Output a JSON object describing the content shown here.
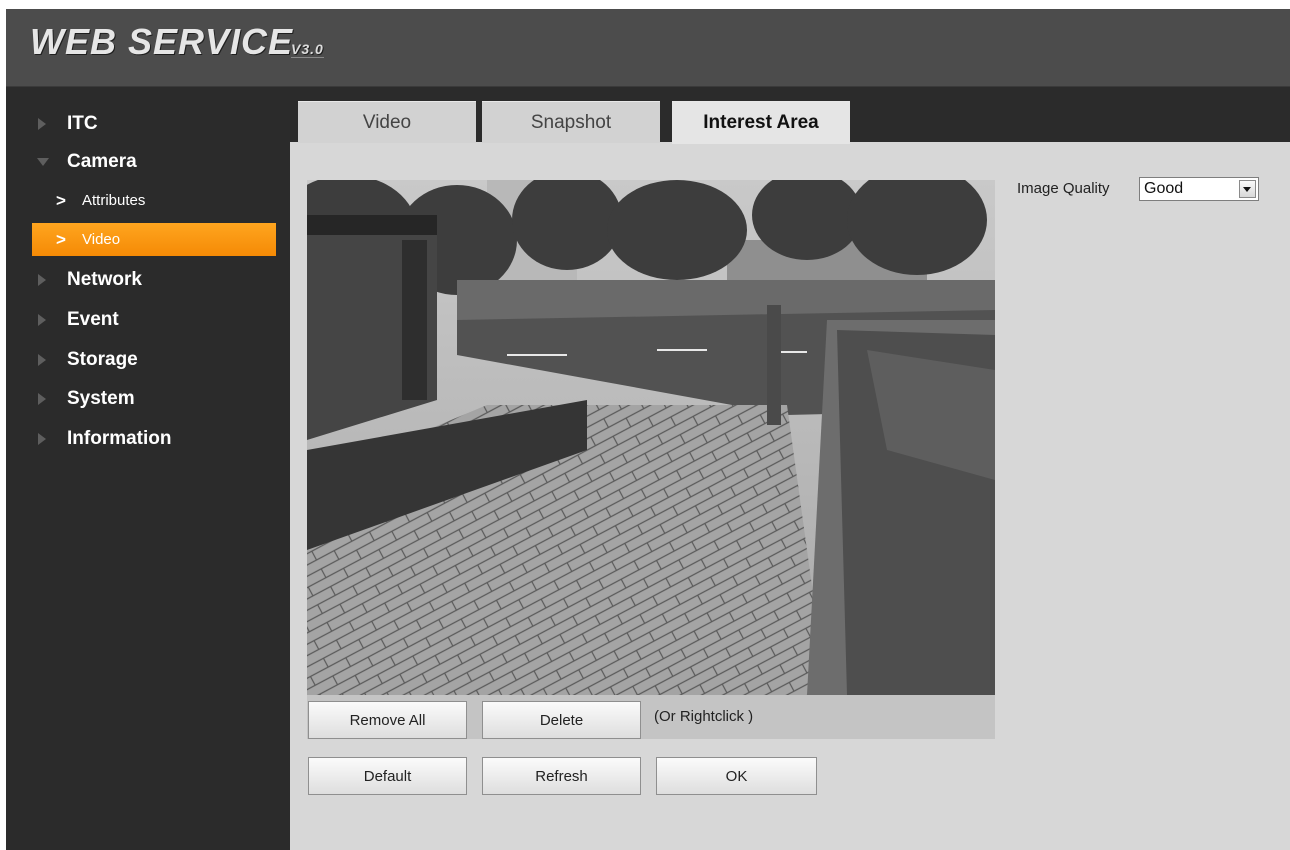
{
  "header": {
    "brand": "WEB SERVICE",
    "version": "V3.0"
  },
  "sidebar": {
    "items": [
      {
        "label": "ITC",
        "expanded": false
      },
      {
        "label": "Camera",
        "expanded": true,
        "children": [
          {
            "label": "Attributes",
            "active": false
          },
          {
            "label": "Video",
            "active": true
          }
        ]
      },
      {
        "label": "Network",
        "expanded": false
      },
      {
        "label": "Event",
        "expanded": false
      },
      {
        "label": "Storage",
        "expanded": false
      },
      {
        "label": "System",
        "expanded": false
      },
      {
        "label": "Information",
        "expanded": false
      }
    ]
  },
  "tabs": [
    {
      "label": "Video",
      "active": false
    },
    {
      "label": "Snapshot",
      "active": false
    },
    {
      "label": "Interest Area",
      "active": true
    }
  ],
  "video_buttons": {
    "remove_all": "Remove All",
    "delete": "Delete",
    "hint": "(Or Rightclick )"
  },
  "actions": {
    "default": "Default",
    "refresh": "Refresh",
    "ok": "OK"
  },
  "image_quality": {
    "label": "Image Quality",
    "value": "Good"
  },
  "colors": {
    "accent": "#f7930c",
    "sidebar_bg": "#2b2b2b",
    "content_bg": "#d7d7d7"
  }
}
